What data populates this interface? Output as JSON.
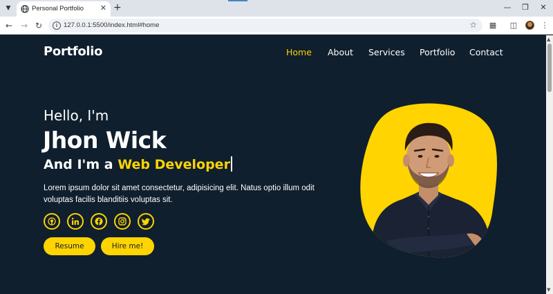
{
  "browser": {
    "tab_title": "Personal Portfolio",
    "url": "127.0.0.1:5500/index.html#home"
  },
  "site": {
    "logo": "Portfolio",
    "nav": [
      "Home",
      "About",
      "Services",
      "Portfolio",
      "Contact"
    ],
    "active_nav": "Home",
    "accent_color": "#ffd400",
    "background_color": "#0f1f2e"
  },
  "hero": {
    "greeting": "Hello, I'm",
    "name": "Jhon Wick",
    "role_prefix": "And I'm a",
    "role": "Web Developer",
    "description": "Lorem ipsum dolor sit amet consectetur, adipisicing elit. Natus optio illum odit voluptas facilis blanditiis voluptas sit.",
    "socials": [
      "github-icon",
      "linkedin-icon",
      "facebook-icon",
      "instagram-icon",
      "twitter-icon"
    ],
    "buttons": {
      "resume": "Resume",
      "hire": "Hire me!"
    }
  }
}
